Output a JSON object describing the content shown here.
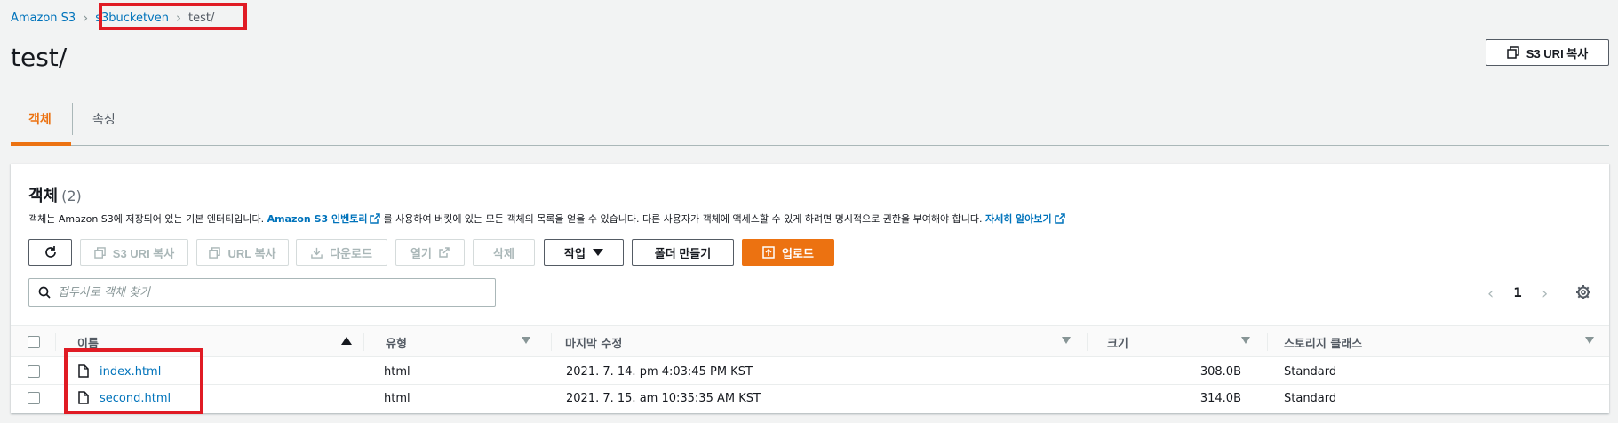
{
  "breadcrumb": {
    "root": "Amazon S3",
    "bucket": "s3bucketven",
    "folder": "test/"
  },
  "page_title": "test/",
  "copy_uri_label": "S3 URI 복사",
  "tabs": [
    {
      "label": "객체"
    },
    {
      "label": "속성"
    }
  ],
  "panel": {
    "title": "객체",
    "count": "(2)",
    "desc_1": "객체는 Amazon S3에 저장되어 있는 기본 엔터티입니다. ",
    "desc_link_1": "Amazon S3 인벤토리",
    "desc_2": "를 사용하여 버킷에 있는 모든 객체의 목록을 얻을 수 있습니다. 다른 사용자가 객체에 액세스할 수 있게 하려면 명시적으로 권한을 부여해야 합니다. ",
    "desc_link_2": "자세히 알아보기"
  },
  "toolbar": {
    "copy_s3_uri": "S3 URI 복사",
    "copy_url": "URL 복사",
    "download": "다운로드",
    "open": "열기",
    "delete": "삭제",
    "actions": "작업",
    "create_folder": "폴더 만들기",
    "upload": "업로드"
  },
  "search": {
    "placeholder": "접두사로 객체 찾기"
  },
  "pager": {
    "page": "1"
  },
  "table": {
    "columns": [
      "이름",
      "유형",
      "마지막 수정",
      "크기",
      "스토리지 클래스"
    ],
    "rows": [
      {
        "name": "index.html",
        "type": "html",
        "modified": "2021. 7. 14. pm 4:03:45 PM KST",
        "size": "308.0B",
        "storage": "Standard"
      },
      {
        "name": "second.html",
        "type": "html",
        "modified": "2021. 7. 15. am 10:35:35 AM KST",
        "size": "314.0B",
        "storage": "Standard"
      }
    ]
  },
  "colors": {
    "accent": "#ec7211",
    "link": "#0073bb",
    "highlight": "#e01b24"
  }
}
